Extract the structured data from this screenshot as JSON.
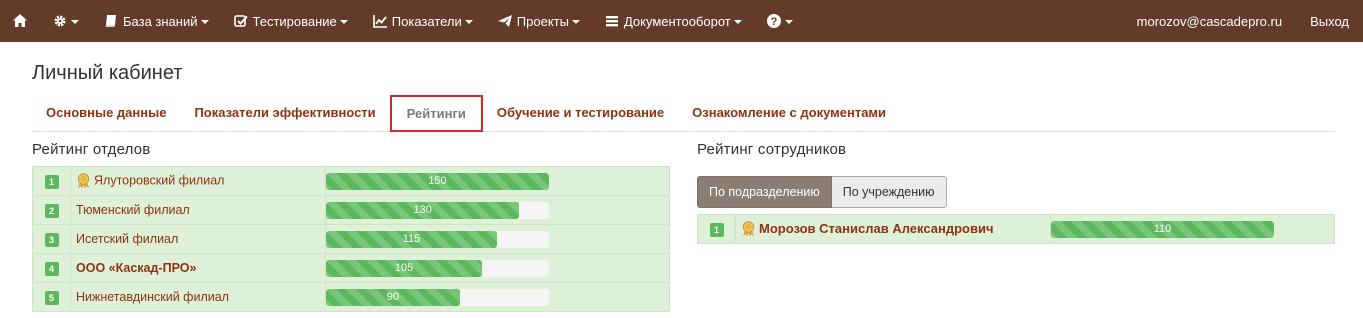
{
  "nav": {
    "items": [
      {
        "name": "home",
        "label": "",
        "icon": "home-icon",
        "caret": false
      },
      {
        "name": "settings",
        "label": "",
        "icon": "gear-icon",
        "caret": true
      },
      {
        "name": "knowledge-base",
        "label": "База знаний",
        "icon": "book-icon",
        "caret": true
      },
      {
        "name": "testing",
        "label": "Тестирование",
        "icon": "checkbox-icon",
        "caret": true
      },
      {
        "name": "indicators",
        "label": "Показатели",
        "icon": "line-chart-icon",
        "caret": true
      },
      {
        "name": "projects",
        "label": "Проекты",
        "icon": "paper-plane-icon",
        "caret": true
      },
      {
        "name": "documents",
        "label": "Документооборот",
        "icon": "list-icon",
        "caret": true
      },
      {
        "name": "help",
        "label": "",
        "icon": "question-circle-icon",
        "caret": true
      }
    ],
    "user_email": "morozov@cascadepro.ru",
    "logout": "Выход"
  },
  "page": {
    "title": "Личный кабинет",
    "tabs": [
      {
        "label": "Основные данные",
        "active": false
      },
      {
        "label": "Показатели эффективности",
        "active": false
      },
      {
        "label": "Рейтинги",
        "active": true
      },
      {
        "label": "Обучение и тестирование",
        "active": false
      },
      {
        "label": "Ознакомление с документами",
        "active": false
      }
    ]
  },
  "departments": {
    "title": "Рейтинг отделов",
    "max": 150,
    "rows": [
      {
        "rank": "1",
        "name": "Ялуторовский филиал",
        "value": 150,
        "label": "150",
        "medal": true,
        "bold": false
      },
      {
        "rank": "2",
        "name": "Тюменский филиал",
        "value": 130,
        "label": "130",
        "medal": false,
        "bold": false
      },
      {
        "rank": "3",
        "name": "Исетский филиал",
        "value": 115,
        "label": "115",
        "medal": false,
        "bold": false
      },
      {
        "rank": "4",
        "name": "ООО «Каскад-ПРО»",
        "value": 105,
        "label": "105",
        "medal": false,
        "bold": true
      },
      {
        "rank": "5",
        "name": "Нижнетавдинский филиал",
        "value": 90,
        "label": "90",
        "medal": false,
        "bold": false
      }
    ]
  },
  "employees": {
    "title": "Рейтинг сотрудников",
    "filters": [
      {
        "label": "По подразделению",
        "active": true
      },
      {
        "label": "По учреждению",
        "active": false
      }
    ],
    "max": 110,
    "rows": [
      {
        "rank": "1",
        "name": "Морозов Станислав Александрович",
        "value": 110,
        "label": "110",
        "medal": true,
        "bold": true
      }
    ]
  },
  "colors": {
    "navbar": "#633b28",
    "link": "#8c3411",
    "progress": "#5cb85c",
    "row_bg": "#dff0d8",
    "active_tab_border": "#d9252a"
  }
}
